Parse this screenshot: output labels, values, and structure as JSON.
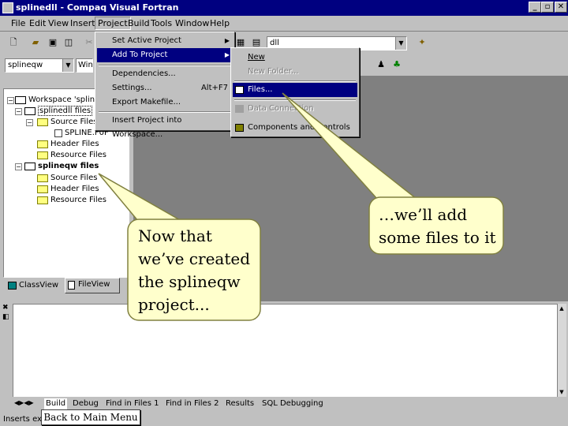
{
  "window": {
    "title": "splinedll - Compaq Visual Fortran",
    "controls": [
      "_",
      "▫",
      "✕"
    ]
  },
  "menubar": {
    "items": [
      "File",
      "Edit",
      "View",
      "Insert",
      "Project",
      "Build",
      "Tools",
      "Window",
      "Help"
    ],
    "active": "Project"
  },
  "toolbar": {
    "config_combo": "dll",
    "project_combo": "splineqw",
    "config_combo2": "Win"
  },
  "project_menu": {
    "items": [
      {
        "label": "Set Active Project",
        "submenu": true
      },
      {
        "label": "Add To Project",
        "submenu": true,
        "highlighted": true
      },
      {
        "label": "Dependencies..."
      },
      {
        "label": "Settings...",
        "shortcut": "Alt+F7"
      },
      {
        "label": "Export Makefile..."
      },
      {
        "label": "Insert Project into Workspace..."
      }
    ]
  },
  "add_submenu": {
    "items": [
      {
        "label": "New",
        "disabled": false
      },
      {
        "label": "New Folder...",
        "disabled": true
      },
      {
        "label": "Files...",
        "highlighted": true
      },
      {
        "label": "Data Connection",
        "disabled": true
      },
      {
        "label": "Components and Controls",
        "disabled": false
      }
    ]
  },
  "workspace": {
    "tree": [
      {
        "label": "Workspace 'splinedll'",
        "icon": "workspace-icon",
        "bold": false
      },
      {
        "label": "splinedll files",
        "icon": "project-icon",
        "bold": false
      },
      {
        "label": "Source Files",
        "icon": "folder-open-icon"
      },
      {
        "label": "SPLINE.F0F",
        "icon": "file-icon"
      },
      {
        "label": "Header Files",
        "icon": "folder-icon"
      },
      {
        "label": "Resource Files",
        "icon": "folder-icon"
      },
      {
        "label": "splineqw files",
        "icon": "project-icon",
        "bold": true
      },
      {
        "label": "Source Files",
        "icon": "folder-icon"
      },
      {
        "label": "Header Files",
        "icon": "folder-icon"
      },
      {
        "label": "Resource Files",
        "icon": "folder-icon"
      }
    ],
    "tabs": [
      "ClassView",
      "FileView"
    ]
  },
  "output": {
    "tabs": [
      "Build",
      "Debug",
      "Find in Files 1",
      "Find in Files 2",
      "Results",
      "SQL Debugging"
    ]
  },
  "statusbar": {
    "text": "Inserts exi"
  },
  "back_button": "Back to Main Menu",
  "callouts": {
    "left": [
      "Now that",
      "we’ve created",
      "the splineqw",
      "project..."
    ],
    "right": [
      "…we’ll add",
      "some files to it"
    ]
  },
  "colors": {
    "titlebar": "#000080",
    "chrome": "#c0c0c0",
    "workarea": "#808080",
    "callout_fill": "#ffffcc",
    "highlight": "#000080"
  }
}
